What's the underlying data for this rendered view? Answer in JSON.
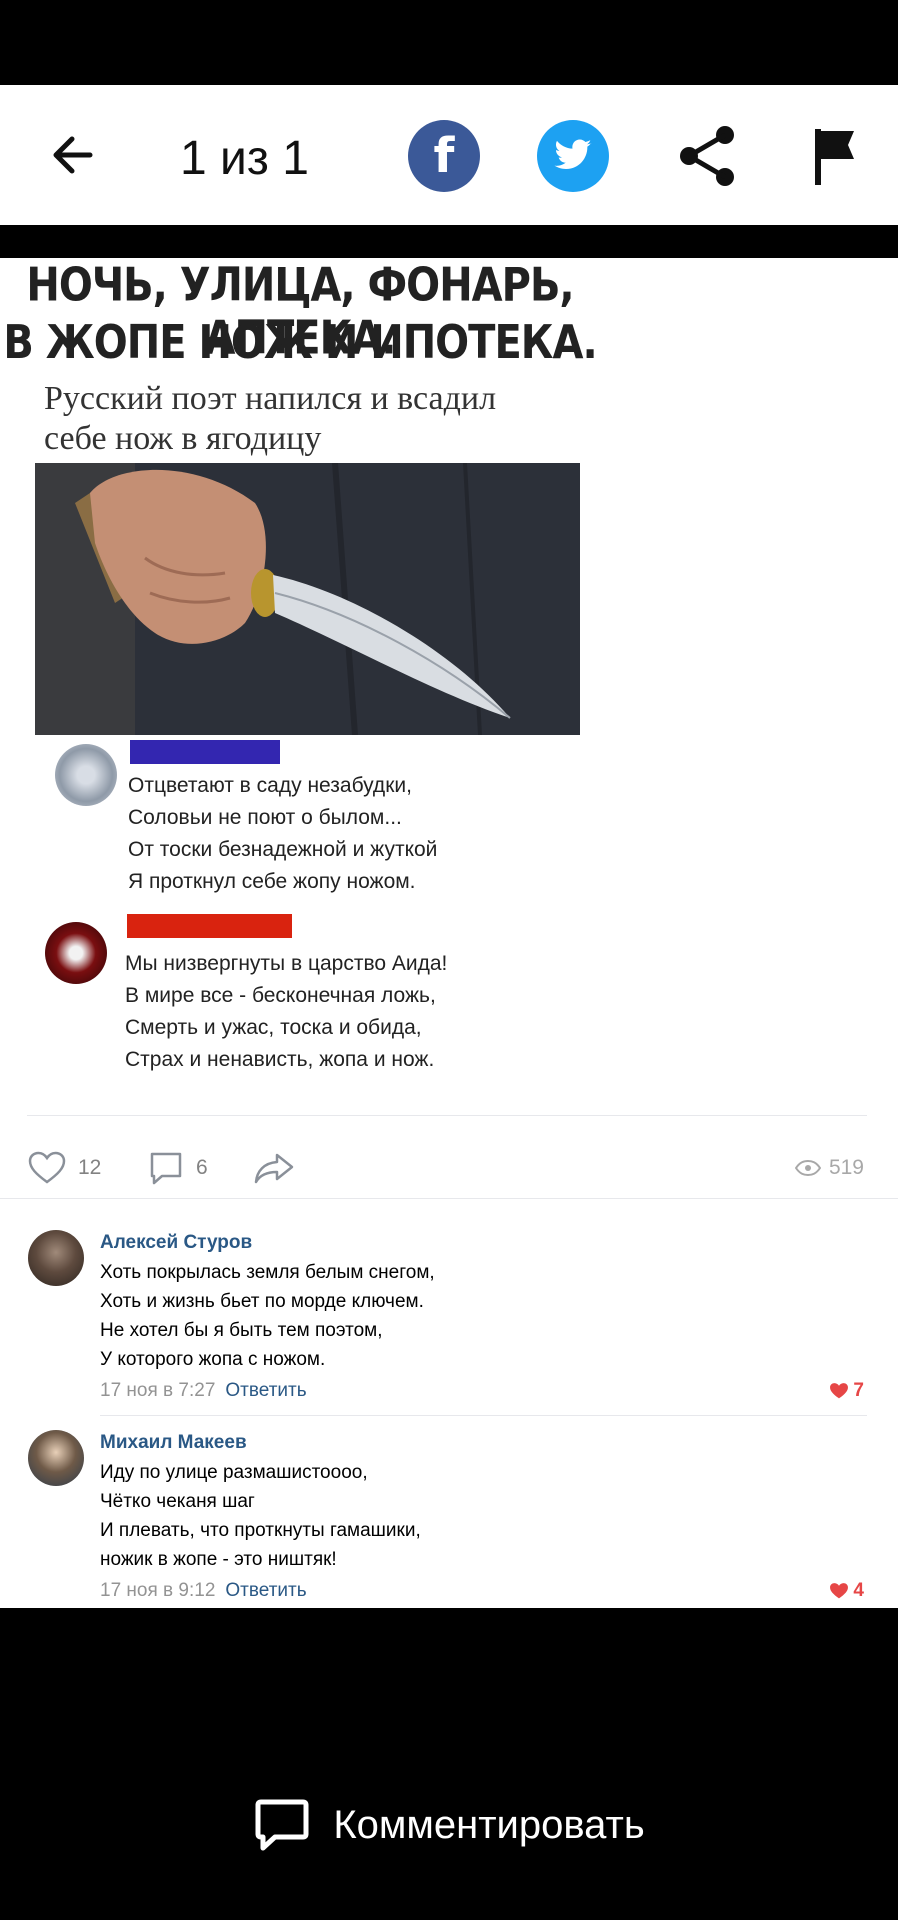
{
  "topbar": {
    "counter": "1 из 1",
    "facebook_glyph": "f"
  },
  "meme": {
    "headline_1": "НОЧЬ, УЛИЦА, ФОНАРЬ, АПТЕКА.",
    "headline_2": "В ЖОПЕ НОЖ И ИПОТЕКА.",
    "subtitle_1": "Русский поэт напился и всадил",
    "subtitle_2": "себе нож в ягодицу",
    "comment_1": {
      "bar_color": "#3326b0",
      "lines": [
        "Отцветают в саду незабудки,",
        "Соловьи не поют о былом...",
        "От тоски безнадежной и жуткой",
        "Я проткнул себе жопу ножом."
      ]
    },
    "comment_2": {
      "bar_color": "#d9230f",
      "lines": [
        "Мы низвергнуты в царство Аида!",
        "В мире все - бесконечная ложь,",
        "Смерть и ужас, тоска и обида,",
        "Страх и ненависть, жопа и нож."
      ]
    }
  },
  "actions": {
    "likes": "12",
    "comments": "6",
    "views": "519"
  },
  "comments": [
    {
      "author": "Алексей Стуров",
      "lines": [
        "Хоть покрылась земля белым снегом,",
        "Хоть и жизнь бьет по морде ключем.",
        "Не хотел бы я быть тем поэтом,",
        "У которого жопа с ножом."
      ],
      "time": "17 ноя в 7:27",
      "reply": "Ответить",
      "likes": "7"
    },
    {
      "author": "Михаил Макеев",
      "lines": [
        "Иду по улице размашистоооо,",
        "Чётко чеканя шаг",
        "И плевать, что проткнуты гамашики,",
        "ножик в жопе - это ништяк!"
      ],
      "time": "17 ноя в 9:12",
      "reply": "Ответить",
      "likes": "4"
    }
  ],
  "bottom": {
    "comment_button": "Комментировать"
  },
  "colors": {
    "link": "#2a5885",
    "like_red": "#e64646",
    "facebook": "#3b5998",
    "twitter": "#1da1f2"
  }
}
